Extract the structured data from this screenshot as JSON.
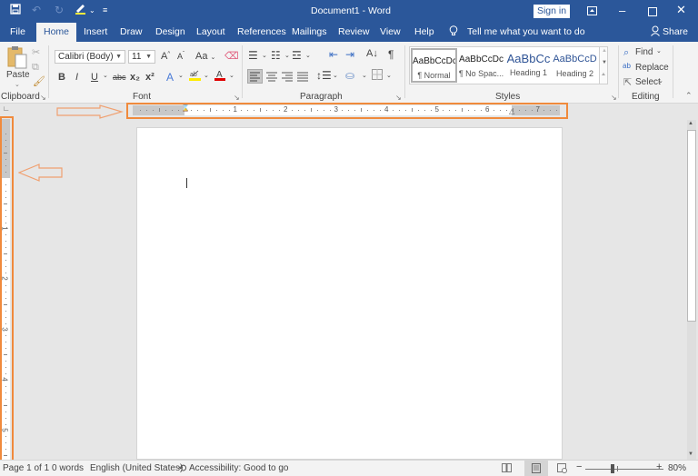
{
  "window": {
    "title": "Document1 - Word",
    "sign_in": "Sign in",
    "controls": [
      "ribbon-display-icon",
      "minimize-icon",
      "maximize-icon",
      "close-icon"
    ]
  },
  "quick_access": [
    "save-icon",
    "undo-icon",
    "redo-icon",
    "highlighter-icon",
    "customize-icon"
  ],
  "tabs": [
    {
      "label": "File",
      "active": false
    },
    {
      "label": "Home",
      "active": true
    },
    {
      "label": "Insert",
      "active": false
    },
    {
      "label": "Draw",
      "active": false
    },
    {
      "label": "Design",
      "active": false
    },
    {
      "label": "Layout",
      "active": false
    },
    {
      "label": "References",
      "active": false
    },
    {
      "label": "Mailings",
      "active": false
    },
    {
      "label": "Review",
      "active": false
    },
    {
      "label": "View",
      "active": false
    },
    {
      "label": "Help",
      "active": false
    }
  ],
  "tell_me": "Tell me what you want to do",
  "share": "Share",
  "ribbon": {
    "clipboard": {
      "label": "Clipboard",
      "paste": "Paste"
    },
    "font": {
      "label": "Font",
      "font_name": "Calibri (Body)",
      "font_size": "11",
      "bold": "B",
      "italic": "I",
      "underline": "U",
      "strike": "abc",
      "subscript": "x₂",
      "superscript": "x²",
      "grow": "A",
      "shrink": "A",
      "case": "Aa"
    },
    "paragraph": {
      "label": "Paragraph"
    },
    "styles": {
      "label": "Styles",
      "items": [
        {
          "preview": "AaBbCcDc",
          "name": "¶ Normal",
          "color": "#222222"
        },
        {
          "preview": "AaBbCcDc",
          "name": "¶ No Spac...",
          "color": "#222222"
        },
        {
          "preview": "AaBbCc",
          "name": "Heading 1",
          "color": "#2f5496"
        },
        {
          "preview": "AaBbCcD",
          "name": "Heading 2",
          "color": "#2f5496"
        }
      ]
    },
    "editing": {
      "label": "Editing",
      "find": "Find",
      "replace": "Replace",
      "select": "Select"
    }
  },
  "ruler": {
    "numbers": [
      "1",
      "1",
      "2",
      "3",
      "4",
      "5",
      "6",
      "7"
    ]
  },
  "vruler": {
    "numbers": [
      "1",
      "2",
      "3",
      "4",
      "5"
    ]
  },
  "status": {
    "page": "Page 1 of 1",
    "words": "0 words",
    "language": "English (United States)",
    "accessibility": "Accessibility: Good to go",
    "zoom": "80%",
    "zoom_minus": "−",
    "zoom_plus": "+"
  },
  "colors": {
    "brand": "#2b579a",
    "highlight": "#f08a3c"
  }
}
